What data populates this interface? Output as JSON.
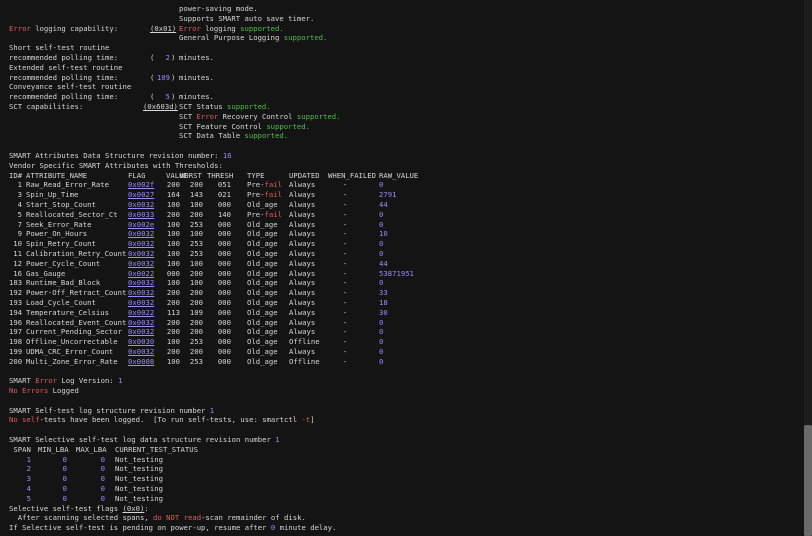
{
  "capabilities": {
    "power_saving": "power-saving mode.",
    "auto_save": "Supports SMART auto save timer.",
    "error_logging_label": "Error",
    "error_logging_rest": " logging capability:",
    "error_logging_code": "(0x01)",
    "error_logging_value_red": "Error",
    "error_logging_value_rest": " logging ",
    "supported": "supported.",
    "gpl_text": "General Purpose Logging ",
    "short_title": "Short self-test routine",
    "polling_label": "recommended polling time:",
    "short_paren": "(",
    "short_value": "2",
    "short_close": ")",
    "minutes": "minutes.",
    "extended_title": "Extended self-test routine",
    "extended_paren": "(",
    "extended_value": "109",
    "extended_close": ")",
    "conveyance_title": "Conveyance self-test routine",
    "conveyance_paren": "(",
    "conveyance_value": "5",
    "conveyance_close": ")",
    "sct_label": "SCT capabilities:",
    "sct_code": "(0x603d)",
    "sct_status": "SCT Status ",
    "sct_error_pre": "SCT ",
    "sct_error_red": "Error",
    "sct_error_rest": " Recovery Control ",
    "sct_feature": "SCT Feature Control ",
    "sct_data": "SCT Data Table "
  },
  "attributes": {
    "revision_label": "SMART Attributes Data Structure revision number: ",
    "revision_value": "16",
    "vendor_title": "Vendor Specific SMART Attributes with Thresholds:",
    "columns": [
      "ID#",
      "ATTRIBUTE_NAME",
      "FLAG",
      "VALUE",
      "WORST",
      "THRESH",
      "TYPE",
      "UPDATED",
      "WHEN_FAILED",
      "RAW_VALUE"
    ],
    "rows": [
      [
        "1",
        "Raw_Read_Error_Rate",
        "0x002f",
        "200",
        "200",
        "051",
        "Pre-fail",
        "Always",
        "-",
        "0"
      ],
      [
        "3",
        "Spin_Up_Time",
        "0x0027",
        "164",
        "143",
        "021",
        "Pre-fail",
        "Always",
        "-",
        "2791"
      ],
      [
        "4",
        "Start_Stop_Count",
        "0x0032",
        "100",
        "100",
        "000",
        "Old_age",
        "Always",
        "-",
        "44"
      ],
      [
        "5",
        "Reallocated_Sector_Ct",
        "0x0033",
        "200",
        "200",
        "140",
        "Pre-fail",
        "Always",
        "-",
        "0"
      ],
      [
        "7",
        "Seek_Error_Rate",
        "0x002e",
        "100",
        "253",
        "000",
        "Old_age",
        "Always",
        "-",
        "0"
      ],
      [
        "9",
        "Power_On_Hours",
        "0x0032",
        "100",
        "100",
        "000",
        "Old_age",
        "Always",
        "-",
        "10"
      ],
      [
        "10",
        "Spin_Retry_Count",
        "0x0032",
        "100",
        "253",
        "000",
        "Old_age",
        "Always",
        "-",
        "0"
      ],
      [
        "11",
        "Calibration_Retry_Count",
        "0x0032",
        "100",
        "253",
        "000",
        "Old_age",
        "Always",
        "-",
        "0"
      ],
      [
        "12",
        "Power_Cycle_Count",
        "0x0032",
        "100",
        "100",
        "000",
        "Old_age",
        "Always",
        "-",
        "44"
      ],
      [
        "16",
        "Gas_Gauge",
        "0x0022",
        "000",
        "200",
        "000",
        "Old_age",
        "Always",
        "-",
        "53871951"
      ],
      [
        "183",
        "Runtime_Bad_Block",
        "0x0032",
        "100",
        "100",
        "000",
        "Old_age",
        "Always",
        "-",
        "0"
      ],
      [
        "192",
        "Power-Off_Retract_Count",
        "0x0032",
        "200",
        "200",
        "000",
        "Old_age",
        "Always",
        "-",
        "33"
      ],
      [
        "193",
        "Load_Cycle_Count",
        "0x0032",
        "200",
        "200",
        "000",
        "Old_age",
        "Always",
        "-",
        "18"
      ],
      [
        "194",
        "Temperature_Celsius",
        "0x0022",
        "113",
        "109",
        "000",
        "Old_age",
        "Always",
        "-",
        "30"
      ],
      [
        "196",
        "Reallocated_Event_Count",
        "0x0032",
        "200",
        "200",
        "000",
        "Old_age",
        "Always",
        "-",
        "0"
      ],
      [
        "197",
        "Current_Pending_Sector",
        "0x0032",
        "200",
        "200",
        "000",
        "Old_age",
        "Always",
        "-",
        "0"
      ],
      [
        "198",
        "Offline_Uncorrectable",
        "0x0030",
        "100",
        "253",
        "000",
        "Old_age",
        "Offline",
        "-",
        "0"
      ],
      [
        "199",
        "UDMA_CRC_Error_Count",
        "0x0032",
        "200",
        "200",
        "000",
        "Old_age",
        "Always",
        "-",
        "0"
      ],
      [
        "200",
        "Multi_Zone_Error_Rate",
        "0x0008",
        "100",
        "253",
        "000",
        "Old_age",
        "Offline",
        "-",
        "0"
      ]
    ]
  },
  "error_log": {
    "version_pre": "SMART ",
    "version_red": "Error",
    "version_rest": " Log Version: ",
    "version_value": "1",
    "no_errors_red": "No Errors",
    "no_errors_rest": " Logged"
  },
  "selftest_log": {
    "revision_label": "SMART Self-test log structure revision number ",
    "revision_value": "1",
    "no_red": "No ",
    "self_red": "self",
    "rest": "-tests have been logged.  [To run self-tests, use: smartctl ",
    "flag": "-t",
    "close": "]"
  },
  "selective": {
    "revision_label": "SMART Selective self-test log data structure revision number ",
    "revision_value": "1",
    "columns": [
      " SPAN",
      "MIN_LBA",
      "MAX_LBA",
      "CURRENT_TEST_STATUS"
    ],
    "rows": [
      [
        "1",
        "0",
        "0",
        "Not_testing"
      ],
      [
        "2",
        "0",
        "0",
        "Not_testing"
      ],
      [
        "3",
        "0",
        "0",
        "Not_testing"
      ],
      [
        "4",
        "0",
        "0",
        "Not_testing"
      ],
      [
        "5",
        "0",
        "0",
        "Not_testing"
      ]
    ],
    "flags_label": "Selective self-test flags ",
    "flags_value": "(0x0)",
    "flags_colon": ":",
    "after_pre": "  After scanning selected spans, ",
    "after_red": "do NOT read",
    "after_rest": "-scan remainder of disk.",
    "pending_pre": "If Selective self-test is pending on power-up, resume after ",
    "pending_value": "0",
    "pending_rest": " minute delay."
  }
}
